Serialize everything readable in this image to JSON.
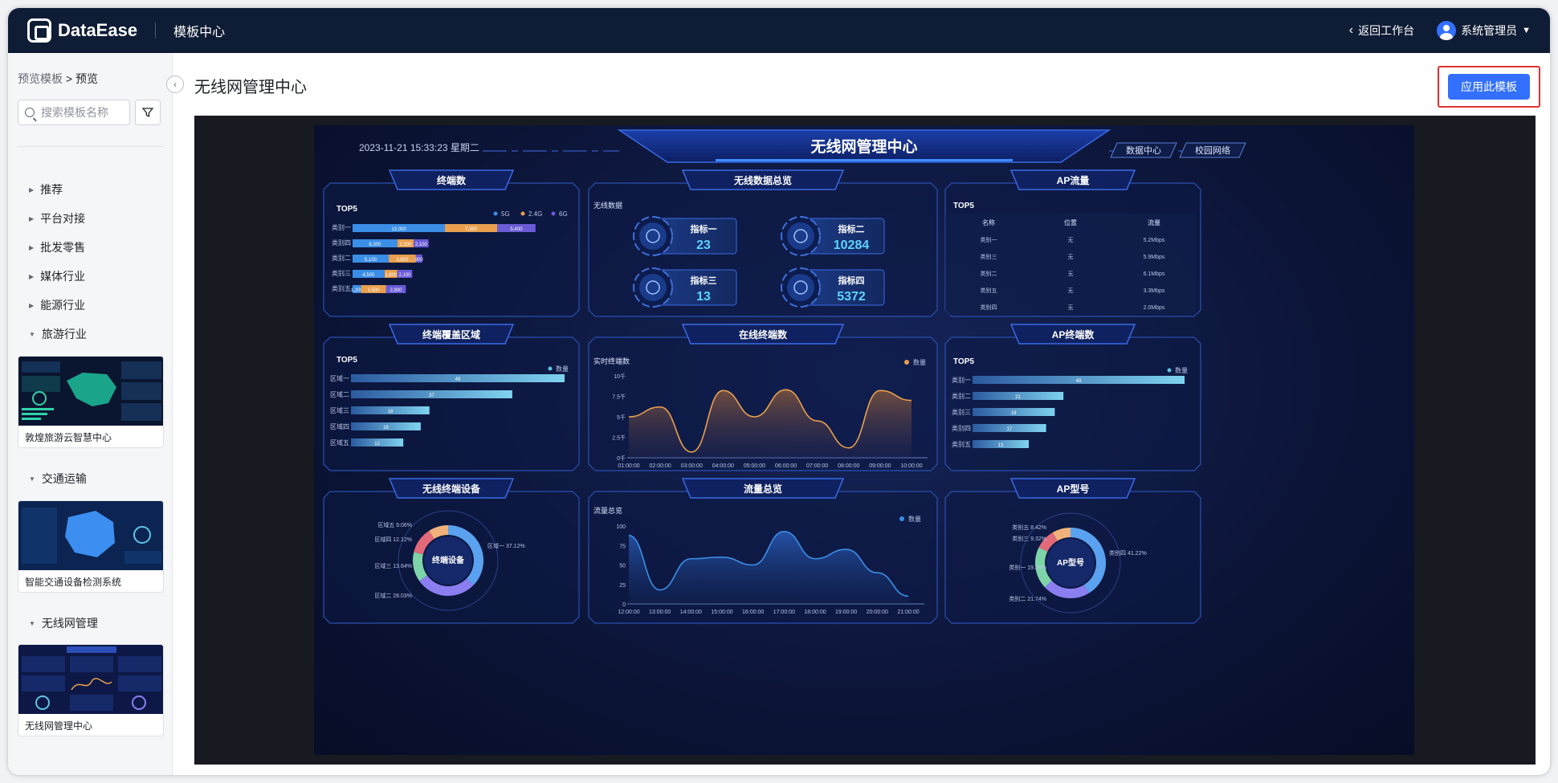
{
  "topbar": {
    "logo": "DataEase",
    "nav": "模板中心",
    "back": "返回工作台",
    "user": "系统管理员"
  },
  "sidebar": {
    "breadcrumb_root": "预览模板",
    "breadcrumb_sep": ">",
    "breadcrumb_current": "预览",
    "search_placeholder": "搜索模板名称",
    "categories": [
      {
        "label": "推荐"
      },
      {
        "label": "平台对接"
      },
      {
        "label": "批发零售"
      },
      {
        "label": "媒体行业"
      },
      {
        "label": "能源行业"
      },
      {
        "label": "旅游行业"
      },
      {
        "label": "交通运输"
      },
      {
        "label": "无线网管理"
      }
    ],
    "templates": [
      {
        "name": "敦煌旅游云智慧中心"
      },
      {
        "name": "智能交通设备检测系统"
      },
      {
        "name": "无线网管理中心"
      }
    ]
  },
  "main": {
    "title": "无线网管理中心",
    "apply_button": "应用此模板"
  },
  "dashboard": {
    "title": "无线网管理中心",
    "datetime": "2023-11-21 15:33:23 星期二",
    "btn1": "数据中心",
    "btn2": "校园网络",
    "panels": {
      "terminals": "终端数",
      "overview": "无线数据总览",
      "ap_flow": "AP流量",
      "coverage": "终端覆盖区域",
      "online": "在线终端数",
      "ap_terminals": "AP终端数",
      "devices": "无线终端设备",
      "traffic": "流量总览",
      "ap_model": "AP型号"
    },
    "top5": "TOP5",
    "wireless_data": "无线数据",
    "realtime": "实时终端数",
    "traffic_total": "流量总览",
    "donut1_center": "终端设备",
    "donut2_center": "AP型号",
    "kpis": [
      {
        "label": "指标一",
        "value": "23"
      },
      {
        "label": "指标二",
        "value": "10284"
      },
      {
        "label": "指标三",
        "value": "13"
      },
      {
        "label": "指标四",
        "value": "5372"
      }
    ],
    "ap_table": {
      "headers": [
        "名称",
        "位置",
        "流量"
      ],
      "rows": [
        [
          "类别一",
          "无",
          "5.2Mbps"
        ],
        [
          "类别三",
          "无",
          "5.9Mbps"
        ],
        [
          "类别二",
          "无",
          "6.1Mbps"
        ],
        [
          "类别五",
          "无",
          "3.3Mbps"
        ],
        [
          "类别四",
          "无",
          "2.0Mbps"
        ]
      ]
    },
    "legend_qty": "数量",
    "donut1_labels": [
      "区域五 9.06%",
      "区域四 12.12%",
      "区域三 13.64%",
      "区域二 28.03%",
      "区域一 37.12%"
    ],
    "donut2_labels": [
      "类别五 8.42%",
      "类别三 9.32%",
      "类别一 19.29%",
      "类别二 21.74%",
      "类别四 41.22%"
    ],
    "colors": {
      "c5g": "#3a8ee6",
      "c24g": "#e8a04e",
      "c6g": "#6a5bd6",
      "teal": "#5fc3e4",
      "orange": "#e8a04e"
    }
  },
  "chart_data": [
    {
      "type": "bar",
      "title": "终端数",
      "categories": [
        "类别一",
        "类别四",
        "类别二",
        "类别三",
        "类别五"
      ],
      "series": [
        {
          "name": "5G",
          "values": [
            13000,
            6300,
            5100,
            4500,
            1200
          ]
        },
        {
          "name": "2.4G",
          "values": [
            7350,
            2300,
            3800,
            1800,
            3500
          ]
        },
        {
          "name": "6G",
          "values": [
            5400,
            2100,
            900,
            2100,
            2800
          ]
        }
      ]
    },
    {
      "type": "bar",
      "title": "终端覆盖区域",
      "categories": [
        "区域一",
        "区域二",
        "区域三",
        "区域四",
        "区域五"
      ],
      "values": [
        49,
        37,
        18,
        16,
        12
      ]
    },
    {
      "type": "area",
      "title": "在线终端数",
      "x": [
        "01:00:00",
        "02:00:00",
        "03:00:00",
        "04:00:00",
        "05:00:00",
        "06:00:00",
        "07:00:00",
        "08:00:00",
        "09:00:00",
        "10:00:00"
      ],
      "y_ticks": [
        "0千",
        "2.5千",
        "5千",
        "7.5千",
        "10千"
      ],
      "values": [
        5000,
        6200,
        700,
        8200,
        5000,
        8300,
        4500,
        1200,
        8200,
        7000
      ],
      "ylim": [
        0,
        10000
      ]
    },
    {
      "type": "bar",
      "title": "AP终端数",
      "categories": [
        "类别一",
        "类别二",
        "类别三",
        "类别四",
        "类别五"
      ],
      "values": [
        49,
        21,
        19,
        17,
        13
      ]
    },
    {
      "type": "pie",
      "title": "无线终端设备",
      "labels": [
        "区域一",
        "区域二",
        "区域三",
        "区域四",
        "区域五"
      ],
      "values": [
        37.12,
        28.03,
        13.64,
        12.12,
        9.06
      ]
    },
    {
      "type": "area",
      "title": "流量总览",
      "x": [
        "12:00:00",
        "13:00:00",
        "14:00:00",
        "15:00:00",
        "16:00:00",
        "17:00:00",
        "18:00:00",
        "19:00:00",
        "20:00:00",
        "21:00:00"
      ],
      "y_ticks": [
        "0",
        "25",
        "50",
        "75",
        "100"
      ],
      "values": [
        88,
        18,
        58,
        60,
        50,
        93,
        58,
        70,
        40,
        10
      ],
      "ylim": [
        0,
        100
      ]
    },
    {
      "type": "pie",
      "title": "AP型号",
      "labels": [
        "类别四",
        "类别二",
        "类别一",
        "类别三",
        "类别五"
      ],
      "values": [
        41.22,
        21.74,
        19.29,
        9.32,
        8.42
      ]
    }
  ]
}
